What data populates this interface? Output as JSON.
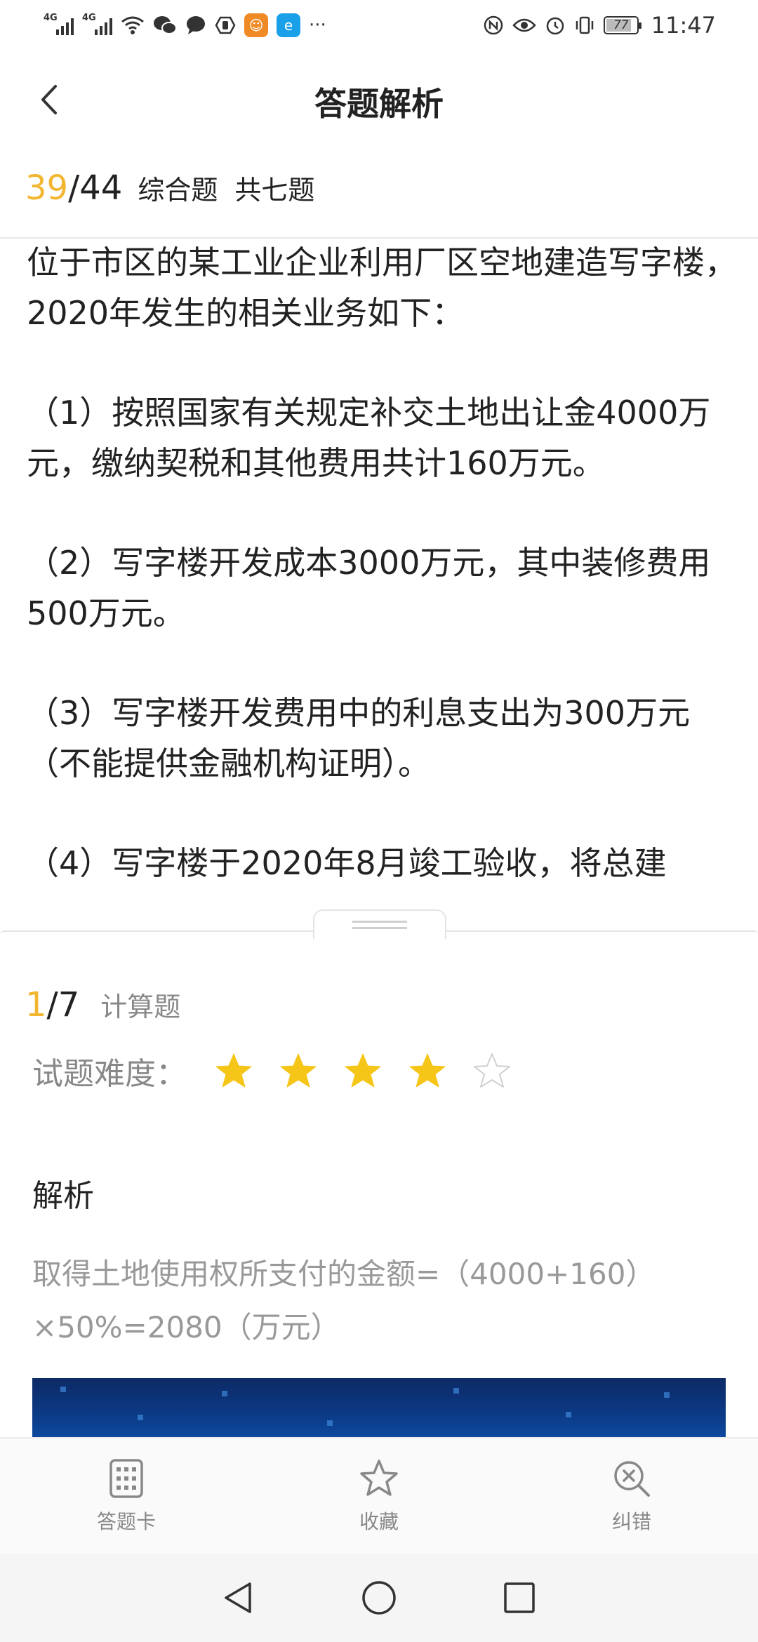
{
  "status_bar": {
    "signal1_label": "4G",
    "signal2_label": "4G",
    "more": "···",
    "battery": "77",
    "battery_level": 0.77,
    "time": "11:47",
    "icons": [
      "wifi-icon",
      "wechat-icon",
      "message-icon",
      "hand-icon",
      "cartoon-app-icon",
      "browser-app-icon",
      "nfc-icon",
      "eye-icon",
      "alarm-icon",
      "vibrate-icon"
    ]
  },
  "header": {
    "title": "答题解析",
    "back_icon": "chevron-left-icon"
  },
  "progress": {
    "current": "39",
    "separator": "/",
    "total": "44",
    "type": "综合题",
    "count": "共七题"
  },
  "question": {
    "paragraphs": [
      "位于市区的某工业企业利用厂区空地建造写字楼，2020年发生的相关业务如下：",
      "（1）按照国家有关规定补交土地出让金4000万元，缴纳契税和其他费用共计160万元。",
      "（2）写字楼开发成本3000万元，其中装修费用500万元。",
      "（3）写字楼开发费用中的利息支出为300万元（不能提供金融机构证明）。",
      "（4）写字楼于2020年8月竣工验收，将总建"
    ]
  },
  "sub_question": {
    "current": "1",
    "separator": "/",
    "total": "7",
    "type": "计算题"
  },
  "difficulty": {
    "label": "试题难度：",
    "stars_filled": 4,
    "stars_total": 5,
    "filled_color": "#f5c518",
    "empty_color": "#d0d0d0"
  },
  "analysis": {
    "title": "解析",
    "line1": "取得土地使用权所支付的金额=（4000+160）",
    "line2": "×50%=2080（万元）"
  },
  "tabbar": {
    "items": [
      {
        "label": "答题卡",
        "icon": "grid-card-icon"
      },
      {
        "label": "收藏",
        "icon": "star-outline-icon"
      },
      {
        "label": "纠错",
        "icon": "error-search-icon"
      }
    ]
  },
  "navbar": {
    "icons": [
      "nav-back-icon",
      "nav-home-icon",
      "nav-recents-icon"
    ]
  },
  "colors": {
    "accent": "#f2b630",
    "muted_text": "#888888"
  }
}
